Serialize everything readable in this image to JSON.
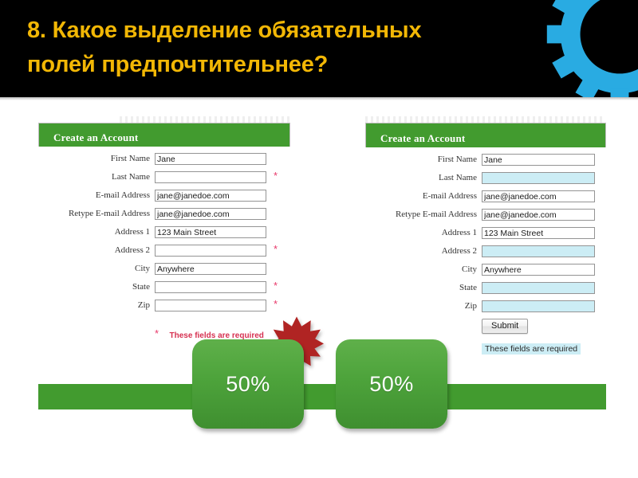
{
  "slide": {
    "title": "8. Какое выделение обязательных\nполей предпочтительнее?",
    "title_color": "#F2B705",
    "header_background": "#000000",
    "gear_icon": "gear-icon",
    "gear_color": "#29ABE2"
  },
  "forms": [
    {
      "id": "left",
      "header_title": "Create an Account",
      "header_color": "#429B2F",
      "required_marker_style": "asterisk",
      "fields": [
        {
          "label": "First Name",
          "value": "Jane",
          "required": true,
          "marked": false
        },
        {
          "label": "Last Name",
          "value": "",
          "required": true,
          "marked": true
        },
        {
          "label": "E-mail Address",
          "value": "jane@janedoe.com",
          "required": true,
          "marked": false
        },
        {
          "label": "Retype E-mail Address",
          "value": "jane@janedoe.com",
          "required": true,
          "marked": false
        },
        {
          "label": "Address 1",
          "value": "123 Main Street",
          "required": true,
          "marked": false
        },
        {
          "label": "Address 2",
          "value": "",
          "required": true,
          "marked": true
        },
        {
          "label": "City",
          "value": "Anywhere",
          "required": true,
          "marked": false
        },
        {
          "label": "State",
          "value": "",
          "required": true,
          "marked": true
        },
        {
          "label": "Zip",
          "value": "",
          "required": true,
          "marked": true
        }
      ],
      "asterisk_glyph": "*",
      "asterisk_color": "#E8396A",
      "legend_text": "These fields are required",
      "legend_color": "#D63050"
    },
    {
      "id": "right",
      "header_title": "Create an Account",
      "header_color": "#429B2F",
      "required_marker_style": "highlight",
      "highlight_color": "#CCEDF5",
      "fields": [
        {
          "label": "First Name",
          "value": "Jane",
          "required": true,
          "marked": false
        },
        {
          "label": "Last Name",
          "value": "",
          "required": true,
          "marked": true
        },
        {
          "label": "E-mail Address",
          "value": "jane@janedoe.com",
          "required": true,
          "marked": false
        },
        {
          "label": "Retype E-mail Address",
          "value": "jane@janedoe.com",
          "required": true,
          "marked": false
        },
        {
          "label": "Address 1",
          "value": "123 Main Street",
          "required": true,
          "marked": false
        },
        {
          "label": "Address 2",
          "value": "",
          "required": true,
          "marked": true
        },
        {
          "label": "City",
          "value": "Anywhere",
          "required": true,
          "marked": false
        },
        {
          "label": "State",
          "value": "",
          "required": true,
          "marked": true
        },
        {
          "label": "Zip",
          "value": "",
          "required": true,
          "marked": true
        }
      ],
      "submit_label": "Submit",
      "legend_text": "These fields are required"
    }
  ],
  "votes": [
    {
      "id": "left-option",
      "percent": "50%"
    },
    {
      "id": "right-option",
      "percent": "50%"
    }
  ],
  "starburst": {
    "name": "red-starburst",
    "color": "#B02423"
  }
}
